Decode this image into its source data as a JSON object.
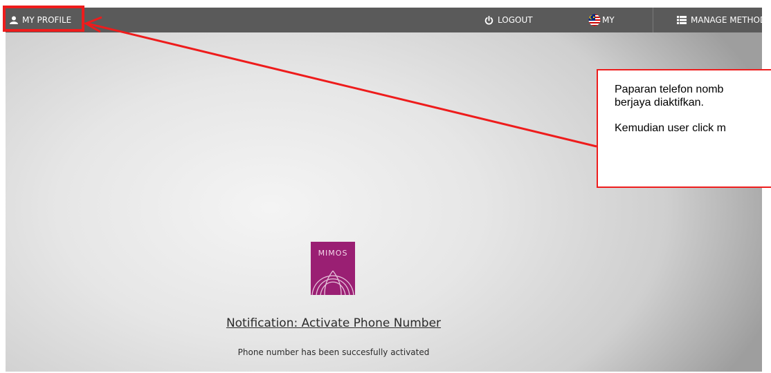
{
  "topbar": {
    "my_profile": "MY PROFILE",
    "logout": "LOGOUT",
    "language": "MY",
    "manage_methods": "MANAGE METHODS"
  },
  "callout": {
    "line1": "Paparan telefon nomb",
    "line2": "berjaya diaktifkan.",
    "line3": "Kemudian user click m"
  },
  "logo": {
    "text": "MIMOS"
  },
  "notification": {
    "title": "Notification: Activate Phone Number",
    "message": "Phone number has been succesfully activated"
  },
  "colors": {
    "topbar": "#5a5a5a",
    "annotation_red": "#ee1c1c",
    "logo_magenta": "#9a1f73"
  }
}
